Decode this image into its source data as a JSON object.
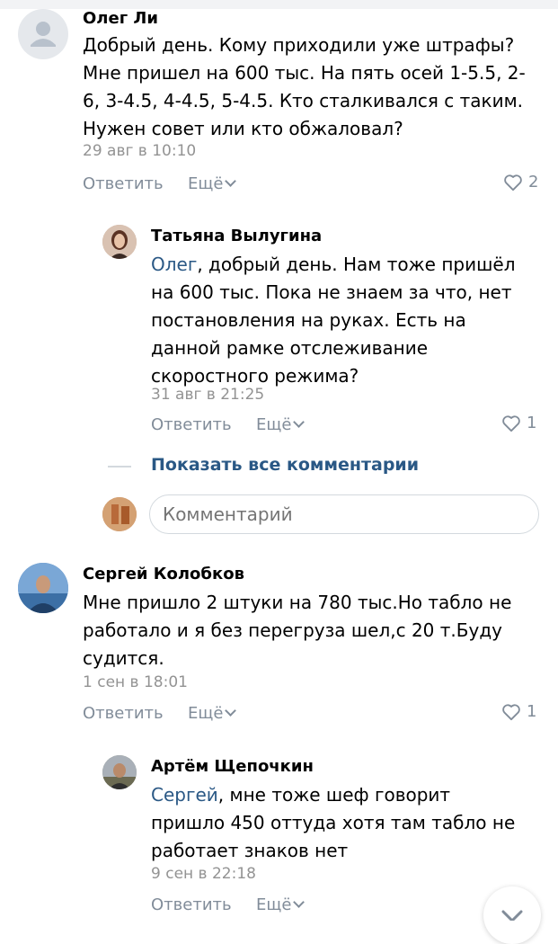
{
  "colors": {
    "link": "#2a5885",
    "secondary": "#818c99",
    "date": "#939393",
    "border": "#d3d9de"
  },
  "comments": [
    {
      "author": "Олег Ли",
      "text": "Добрый день. Кому приходили уже штрафы? Мне пришел на 600 тыс. На пять осей 1-5.5, 2-6, 3-4.5, 4-4.5, 5-4.5. Кто сталкивался с таким. Нужен совет или кто обжаловал?",
      "date": "29 авг в 10:10",
      "reply_label": "Ответить",
      "more_label": "Ещё",
      "likes": "2",
      "avatar_icon": "default-user-avatar"
    },
    {
      "author": "Татьяна Вылугина",
      "mention": "Олег",
      "text": ", добрый день. Нам тоже пришёл на 600 тыс. Пока не знаем за что, нет постановления на руках. Есть на данной рамке отслеживание скоростного режима?",
      "date": "31 авг в 21:25",
      "reply_label": "Ответить",
      "more_label": "Ещё",
      "likes": "1"
    },
    {
      "author": "Сергей Колобков",
      "text": "Мне пришло 2 штуки на 780 тыс.Но табло не работало и я без перегруза шел,с 20 т.Буду судится.",
      "date": "1 сен в 18:01",
      "reply_label": "Ответить",
      "more_label": "Ещё",
      "likes": "1"
    },
    {
      "author": "Артём Щепочкин",
      "mention": "Сергей",
      "text": ", мне тоже шеф говорит пришло 450 оттуда хотя там табло не работает знаков нет",
      "date": "9 сен в 22:18",
      "reply_label": "Ответить",
      "more_label": "Ещё"
    }
  ],
  "show_all_label": "Показать все комментарии",
  "comment_input": {
    "placeholder": "Комментарий"
  }
}
